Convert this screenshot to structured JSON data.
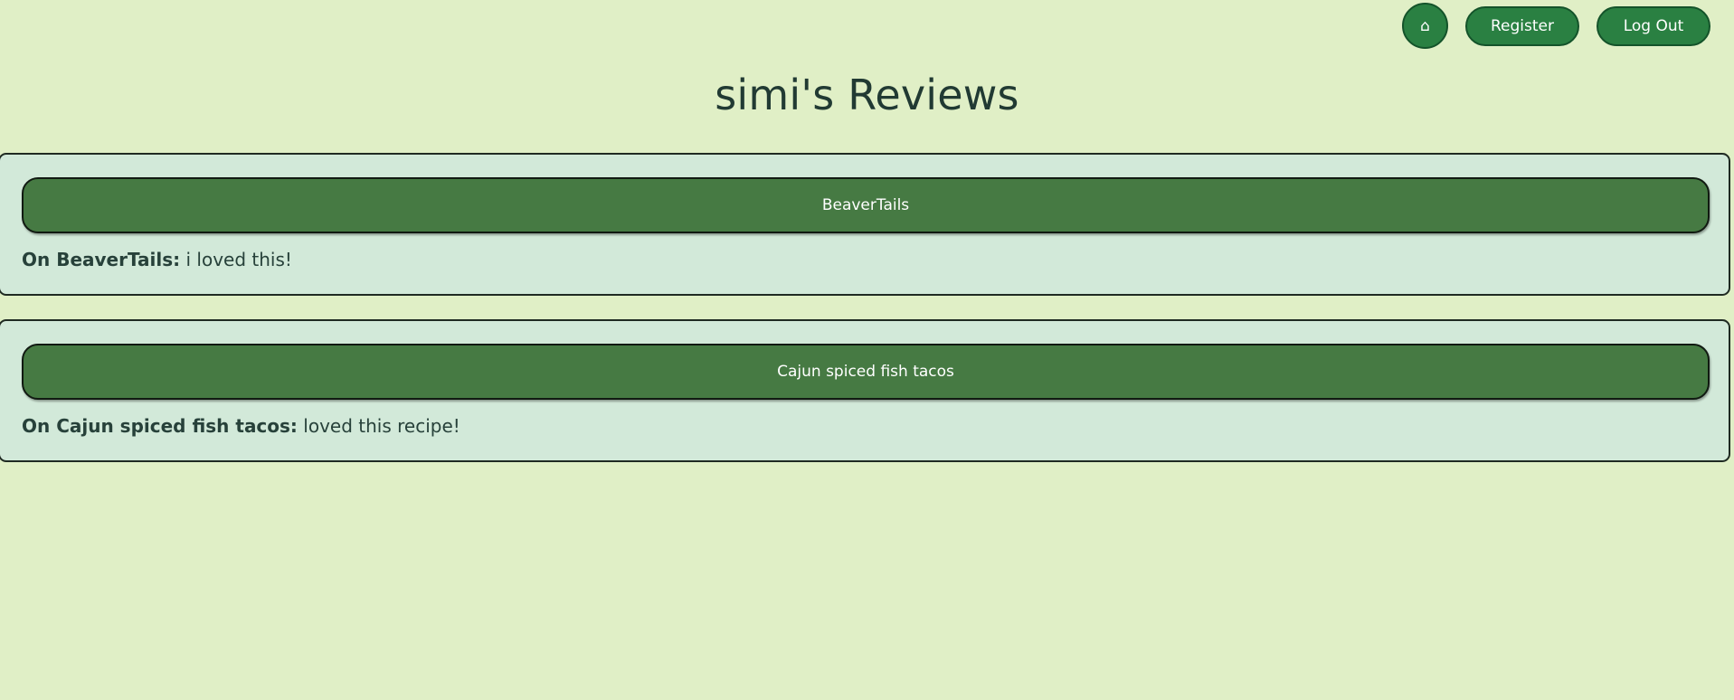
{
  "nav": {
    "home_label": "⌂",
    "register_label": "Register",
    "logout_label": "Log Out"
  },
  "page": {
    "title": "simi's Reviews"
  },
  "reviews": [
    {
      "item_name": "BeaverTails",
      "on_label": "On BeaverTails:",
      "comment": " i loved this!"
    },
    {
      "item_name": "Cajun spiced fish tacos",
      "on_label": "On Cajun spiced fish tacos:",
      "comment": " loved this recipe!"
    }
  ],
  "colors": {
    "background": "#e0efc6",
    "nav_button": "#2a8042",
    "card_background": "#d2e9d9",
    "item_button": "#467a43",
    "text": "#213a33"
  }
}
